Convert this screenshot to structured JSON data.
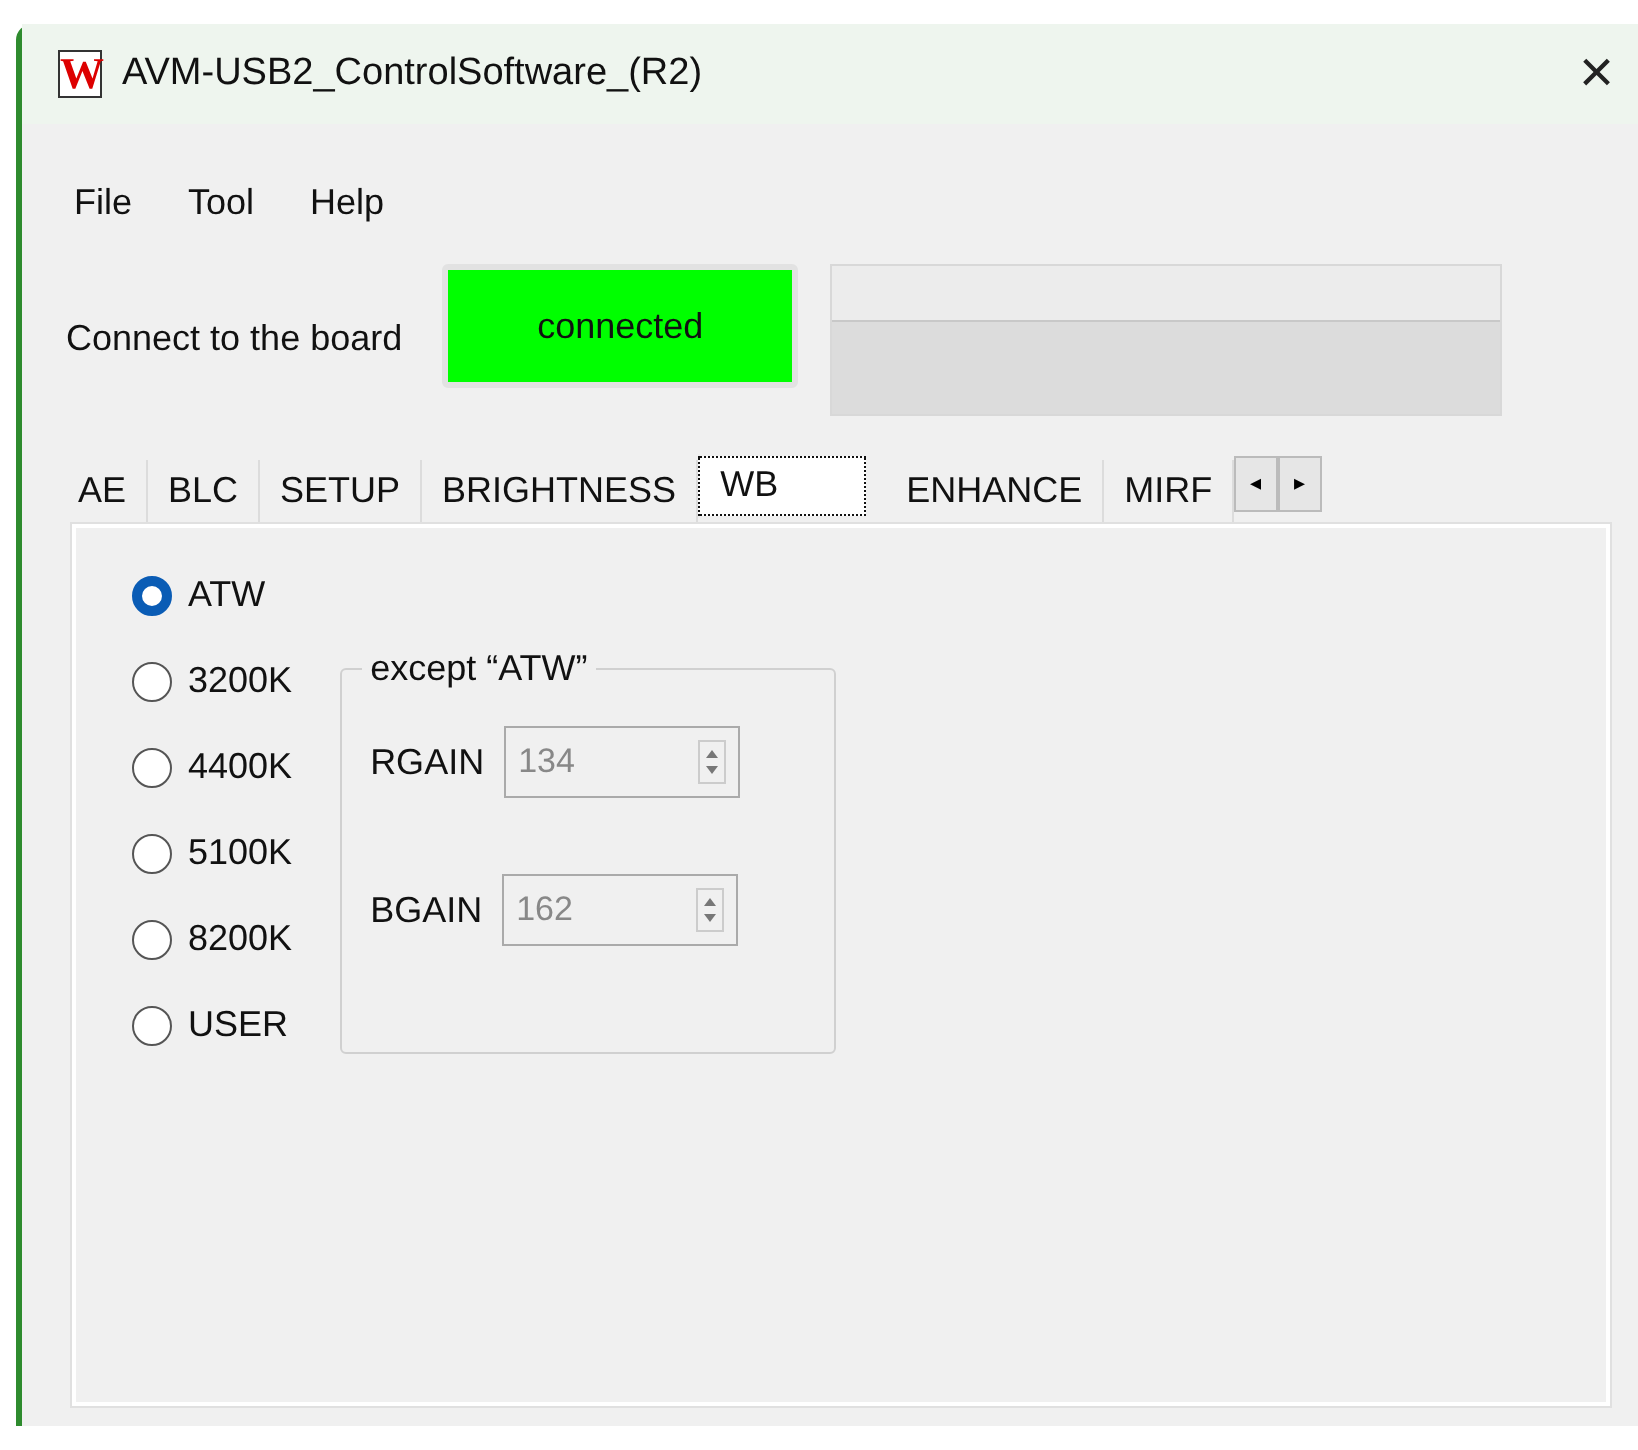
{
  "window": {
    "title": "AVM-USB2_ControlSoftware_(R2)",
    "logo": "W",
    "close": "×"
  },
  "menu": [
    "File",
    "Tool",
    "Help"
  ],
  "connection": {
    "label": "Connect to the board",
    "status": "connected",
    "color": "#00ff00"
  },
  "tabs": [
    {
      "label": "AE",
      "selected": false
    },
    {
      "label": "BLC",
      "selected": false
    },
    {
      "label": "SETUP",
      "selected": false
    },
    {
      "label": "BRIGHTNESS",
      "selected": false
    },
    {
      "label": "WB",
      "selected": true
    },
    {
      "label": "ENHANCE",
      "selected": false
    },
    {
      "label": "MIRF",
      "selected": false
    }
  ],
  "tab_scroll": [
    "◂",
    "▸"
  ],
  "modes": [
    {
      "label": "ATW",
      "selected": true
    },
    {
      "label": "3200K",
      "selected": false
    },
    {
      "label": "4400K",
      "selected": false
    },
    {
      "label": "5100K",
      "selected": false
    },
    {
      "label": "8200K",
      "selected": false
    },
    {
      "label": "USER",
      "selected": false
    }
  ],
  "group": {
    "title": "except “ATW”",
    "fields": [
      {
        "label": "RGAIN",
        "value": "134",
        "disabled": true
      },
      {
        "label": "BGAIN",
        "value": "162",
        "disabled": true
      }
    ]
  }
}
